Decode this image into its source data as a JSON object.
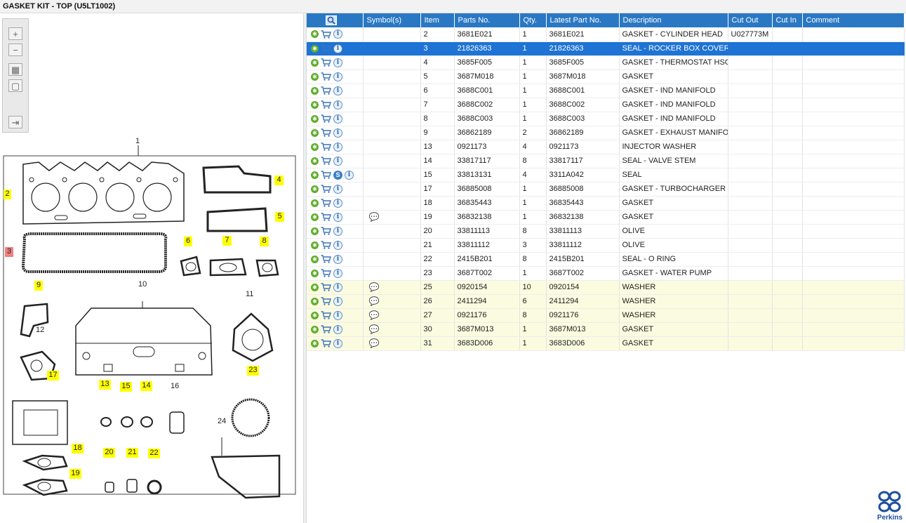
{
  "window": {
    "title": "GASKET KIT - TOP (U5LT1002)"
  },
  "toolbar": {
    "tools": [
      {
        "name": "zoom-in",
        "glyph": "+"
      },
      {
        "name": "zoom-out",
        "glyph": "−"
      },
      {
        "name": "fit-all",
        "glyph": "▦"
      },
      {
        "name": "fit-selection",
        "glyph": "▢"
      },
      {
        "name": "export",
        "glyph": "⇥"
      }
    ]
  },
  "diagram": {
    "callouts": [
      "1",
      "2",
      "3",
      "4",
      "5",
      "6",
      "7",
      "8",
      "9",
      "10",
      "11",
      "12",
      "13",
      "14",
      "15",
      "16",
      "17",
      "18",
      "19",
      "20",
      "21",
      "22",
      "23",
      "24"
    ],
    "selected_callout": "3",
    "highlight_color": "#ffff00",
    "selected_color": "#f08080"
  },
  "table": {
    "columns": [
      "",
      "Symbol(s)",
      "Item",
      "Parts No.",
      "Qty.",
      "Latest Part No.",
      "Description",
      "Cut Out",
      "Cut In",
      "Comment"
    ],
    "rows": [
      {
        "item": "2",
        "part": "3681E021",
        "qty": "1",
        "latest": "3681E021",
        "desc": "GASKET - CYLINDER HEAD",
        "cutout": "U027773M",
        "cutin": "",
        "comment": ""
      },
      {
        "item": "3",
        "part": "21826363",
        "qty": "1",
        "latest": "21826363",
        "desc": "SEAL - ROCKER BOX COVER",
        "cutout": "",
        "cutin": "",
        "comment": ""
      },
      {
        "item": "4",
        "part": "3685F005",
        "qty": "1",
        "latest": "3685F005",
        "desc": "GASKET - THERMOSTAT HSG",
        "cutout": "",
        "cutin": "",
        "comment": ""
      },
      {
        "item": "5",
        "part": "3687M018",
        "qty": "1",
        "latest": "3687M018",
        "desc": "GASKET",
        "cutout": "",
        "cutin": "",
        "comment": ""
      },
      {
        "item": "6",
        "part": "3688C001",
        "qty": "1",
        "latest": "3688C001",
        "desc": "GASKET - IND MANIFOLD",
        "cutout": "",
        "cutin": "",
        "comment": ""
      },
      {
        "item": "7",
        "part": "3688C002",
        "qty": "1",
        "latest": "3688C002",
        "desc": "GASKET - IND MANIFOLD",
        "cutout": "",
        "cutin": "",
        "comment": ""
      },
      {
        "item": "8",
        "part": "3688C003",
        "qty": "1",
        "latest": "3688C003",
        "desc": "GASKET - IND MANIFOLD",
        "cutout": "",
        "cutin": "",
        "comment": ""
      },
      {
        "item": "9",
        "part": "36862189",
        "qty": "2",
        "latest": "36862189",
        "desc": "GASKET - EXHAUST MANIFOLD",
        "cutout": "",
        "cutin": "",
        "comment": ""
      },
      {
        "item": "13",
        "part": "0921173",
        "qty": "4",
        "latest": "0921173",
        "desc": "INJECTOR WASHER",
        "cutout": "",
        "cutin": "",
        "comment": ""
      },
      {
        "item": "14",
        "part": "33817117",
        "qty": "8",
        "latest": "33817117",
        "desc": "SEAL - VALVE STEM",
        "cutout": "",
        "cutin": "",
        "comment": ""
      },
      {
        "item": "15",
        "part": "33813131",
        "qty": "4",
        "latest": "3311A042",
        "desc": "SEAL",
        "cutout": "",
        "cutin": "",
        "comment": ""
      },
      {
        "item": "17",
        "part": "36885008",
        "qty": "1",
        "latest": "36885008",
        "desc": "GASKET - TURBOCHARGER",
        "cutout": "",
        "cutin": "",
        "comment": ""
      },
      {
        "item": "18",
        "part": "36835443",
        "qty": "1",
        "latest": "36835443",
        "desc": "GASKET",
        "cutout": "",
        "cutin": "",
        "comment": ""
      },
      {
        "item": "19",
        "part": "36832138",
        "qty": "1",
        "latest": "36832138",
        "desc": "GASKET",
        "cutout": "",
        "cutin": "",
        "comment": ""
      },
      {
        "item": "20",
        "part": "33811113",
        "qty": "8",
        "latest": "33811113",
        "desc": "OLIVE",
        "cutout": "",
        "cutin": "",
        "comment": ""
      },
      {
        "item": "21",
        "part": "33811112",
        "qty": "3",
        "latest": "33811112",
        "desc": "OLIVE",
        "cutout": "",
        "cutin": "",
        "comment": ""
      },
      {
        "item": "22",
        "part": "2415B201",
        "qty": "8",
        "latest": "2415B201",
        "desc": "SEAL - O RING",
        "cutout": "",
        "cutin": "",
        "comment": ""
      },
      {
        "item": "23",
        "part": "3687T002",
        "qty": "1",
        "latest": "3687T002",
        "desc": "GASKET - WATER PUMP",
        "cutout": "",
        "cutin": "",
        "comment": ""
      },
      {
        "item": "25",
        "part": "0920154",
        "qty": "10",
        "latest": "0920154",
        "desc": "WASHER",
        "cutout": "",
        "cutin": "",
        "comment": ""
      },
      {
        "item": "26",
        "part": "2411294",
        "qty": "6",
        "latest": "2411294",
        "desc": "WASHER",
        "cutout": "",
        "cutin": "",
        "comment": ""
      },
      {
        "item": "27",
        "part": "0921176",
        "qty": "8",
        "latest": "0921176",
        "desc": "WASHER",
        "cutout": "",
        "cutin": "",
        "comment": ""
      },
      {
        "item": "30",
        "part": "3687M013",
        "qty": "1",
        "latest": "3687M013",
        "desc": "GASKET",
        "cutout": "",
        "cutin": "",
        "comment": ""
      },
      {
        "item": "31",
        "part": "3683D006",
        "qty": "1",
        "latest": "3683D006",
        "desc": "GASKET",
        "cutout": "",
        "cutin": "",
        "comment": ""
      }
    ]
  },
  "brand": {
    "name": "Perkins",
    "color": "#1d4f9c"
  },
  "colors": {
    "header": "#2a78c4",
    "selected_row": "#1e73d4",
    "note_row": "#fbfbe0"
  }
}
